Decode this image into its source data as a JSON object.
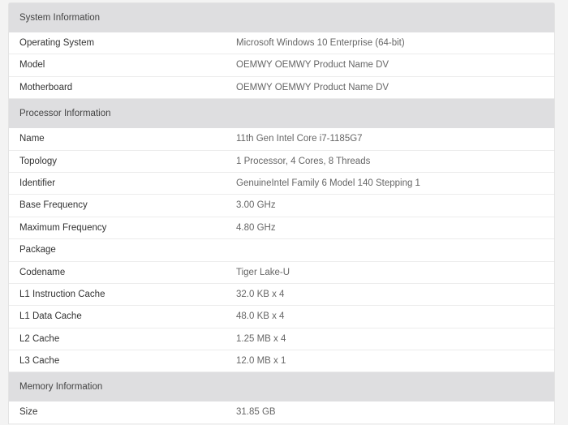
{
  "sections": [
    {
      "title": "System Information",
      "rows": [
        {
          "label": "Operating System",
          "value": "Microsoft Windows 10 Enterprise (64-bit)"
        },
        {
          "label": "Model",
          "value": "OEMWY OEMWY Product Name DV"
        },
        {
          "label": "Motherboard",
          "value": "OEMWY OEMWY Product Name DV"
        }
      ]
    },
    {
      "title": "Processor Information",
      "rows": [
        {
          "label": "Name",
          "value": "11th Gen Intel Core i7-1185G7"
        },
        {
          "label": "Topology",
          "value": "1 Processor, 4 Cores, 8 Threads"
        },
        {
          "label": "Identifier",
          "value": "GenuineIntel Family 6 Model 140 Stepping 1"
        },
        {
          "label": "Base Frequency",
          "value": "3.00 GHz"
        },
        {
          "label": "Maximum Frequency",
          "value": "4.80 GHz"
        },
        {
          "label": "Package",
          "value": ""
        },
        {
          "label": "Codename",
          "value": "Tiger Lake-U"
        },
        {
          "label": "L1 Instruction Cache",
          "value": "32.0 KB x 4"
        },
        {
          "label": "L1 Data Cache",
          "value": "48.0 KB x 4"
        },
        {
          "label": "L2 Cache",
          "value": "1.25 MB x 4"
        },
        {
          "label": "L3 Cache",
          "value": "12.0 MB x 1"
        }
      ]
    },
    {
      "title": "Memory Information",
      "rows": [
        {
          "label": "Size",
          "value": "31.85 GB"
        }
      ]
    }
  ]
}
